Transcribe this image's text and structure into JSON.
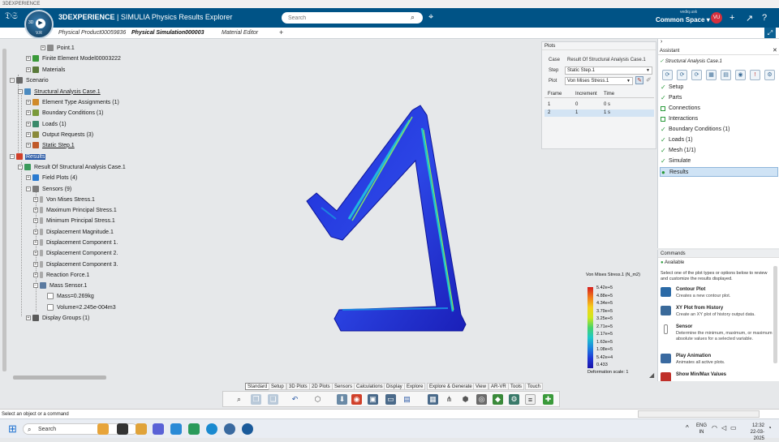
{
  "window": {
    "title": "3DEXPERIENCE"
  },
  "header": {
    "brand_bold": "3DEXPERIENCE",
    "brand_rest": " | SIMULIA Physics Results Explorer",
    "compass_3d": "3D",
    "compass_version": "V.R",
    "search_placeholder": "Search",
    "user_small": "vediq.usk",
    "space": "Common Space",
    "avatar": "VU"
  },
  "tabs": [
    {
      "label": "Physical Product00059836"
    },
    {
      "label": "Physical Simulation000003"
    },
    {
      "label": "Material Editor"
    },
    {
      "label": "+"
    }
  ],
  "tree": {
    "n0": "Point.1",
    "n1": "Finite Element Model00003222",
    "n2": "Materials",
    "n3": "Scenario",
    "n4": "Structural Analysis Case.1",
    "n5": "Element Type Assignments (1)",
    "n6": "Boundary Conditions (1)",
    "n7": "Loads (1)",
    "n8": "Output Requests (3)",
    "n9": "Static Step.1",
    "n10": "Results",
    "n11": "Result Of Structural Analysis Case.1",
    "n12": "Field Plots (4)",
    "n13": "Sensors (9)",
    "n14": "Von Mises Stress.1",
    "n15": "Maximum Principal Stress.1",
    "n16": "Minimum Principal Stress.1",
    "n17": "Displacement Magnitude.1",
    "n18": "Displacement Component 1.",
    "n19": "Displacement Component 2.",
    "n20": "Displacement Component 3.",
    "n21": "Reaction Force.1",
    "n22": "Mass Sensor.1",
    "n23": "Mass=0.269kg",
    "n24": "Volume=2.245e-004m3",
    "n25": "Display Groups (1)"
  },
  "plots": {
    "title": "Plots",
    "case_label": "Case",
    "case_value": "Result Of Structural Analysis Case.1",
    "step_label": "Step",
    "step_value": "Static Step.1",
    "plot_label": "Plot",
    "plot_value": "Von Mises Stress.1",
    "columns": [
      "Frame",
      "Increment",
      "Time"
    ],
    "rows": [
      {
        "frame": "1",
        "increment": "0",
        "time": "0 s"
      },
      {
        "frame": "2",
        "increment": "1",
        "time": "1 s"
      }
    ]
  },
  "assistant": {
    "title": "Assistant",
    "case": "Structural Analysis Case.1",
    "items": [
      "Setup",
      "Parts",
      "Connections",
      "Interactions",
      "Boundary Conditions (1)",
      "Loads (1)",
      "Mesh (1/1)",
      "Simulate",
      "Results"
    ]
  },
  "commands": {
    "title": "Commands",
    "status": "Available",
    "intro": "Select one of the plot types or options below to review and customize the results displayed.",
    "list": [
      {
        "title": "Contour Plot",
        "desc": "Creates a new contour plot."
      },
      {
        "title": "XY Plot from History",
        "desc": "Create an XY plot of history output data."
      },
      {
        "title": "Sensor",
        "desc": "Determine the minimum, maximum, or maximum absolute values for a selected variable."
      },
      {
        "title": "Play Animation",
        "desc": "Animates all active plots."
      },
      {
        "title": "Show Min/Max Values",
        "desc": ""
      }
    ]
  },
  "legend": {
    "title": "Von Mises Stress.1 (N_m2)",
    "values": [
      "5.42e+5",
      "4.88e+5",
      "4.34e+5",
      "3.79e+5",
      "3.25e+5",
      "2.71e+5",
      "2.17e+5",
      "1.63e+5",
      "1.08e+5",
      "5.42e+4",
      "0.433"
    ],
    "scale": "Deformation scale: 1"
  },
  "toolbar_tabs": [
    "Standard",
    "Setup",
    "3D Plots",
    "2D Plots",
    "Sensors",
    "Calculations",
    "Display",
    "Explore",
    "Explore & Generate",
    "View",
    "AR-VR",
    "Tools",
    "Touch"
  ],
  "statusbar": {
    "text": "Select an object or a command"
  },
  "taskbar": {
    "search": "Search",
    "lang1": "ENG",
    "lang2": "IN",
    "time": "12:32",
    "date": "22-03-2025"
  }
}
